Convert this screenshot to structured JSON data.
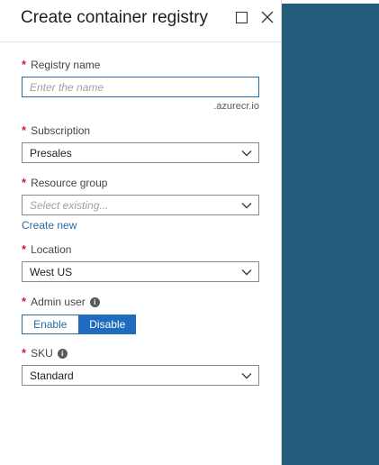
{
  "blade": {
    "title": "Create container registry"
  },
  "form": {
    "registry_name": {
      "label": "Registry name",
      "required_mark": "*",
      "value": "",
      "placeholder": "Enter the name",
      "suffix": ".azurecr.io"
    },
    "subscription": {
      "label": "Subscription",
      "required_mark": "*",
      "value": "Presales"
    },
    "resource_group": {
      "label": "Resource group",
      "required_mark": "*",
      "placeholder": "Select existing...",
      "create_new_link": "Create new"
    },
    "location": {
      "label": "Location",
      "required_mark": "*",
      "value": "West US"
    },
    "admin_user": {
      "label": "Admin user",
      "required_mark": "*",
      "info_icon": "i",
      "options": [
        "Enable",
        "Disable"
      ],
      "selected": "Disable"
    },
    "sku": {
      "label": "SKU",
      "required_mark": "*",
      "info_icon": "i",
      "value": "Standard"
    }
  },
  "colors": {
    "accent": "#1e6bbf",
    "required": "#c4262e",
    "backdrop": "#245c7c",
    "link": "#2b6ca3"
  },
  "icons": {
    "maximize": "maximize-icon",
    "close": "close-icon",
    "chevron": "chevron-down-icon",
    "info": "info-icon"
  }
}
